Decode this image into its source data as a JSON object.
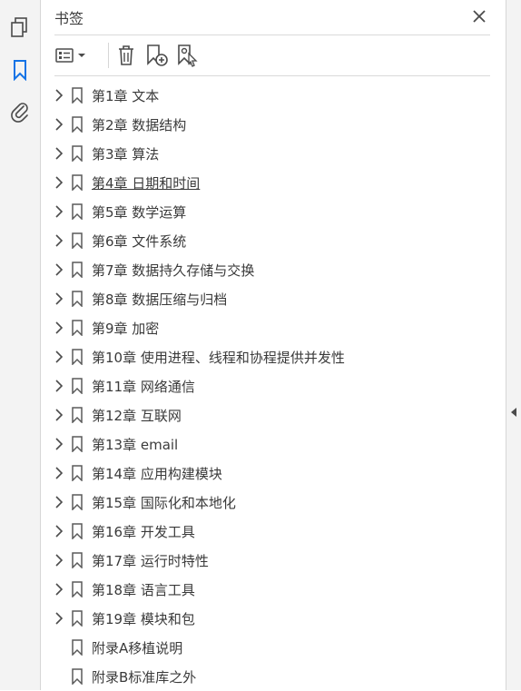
{
  "panel": {
    "title": "书签"
  },
  "bookmarks": [
    {
      "label": "第1章 文本",
      "expandable": true
    },
    {
      "label": "第2章 数据结构",
      "expandable": true
    },
    {
      "label": "第3章 算法",
      "expandable": true
    },
    {
      "label": "第4章 日期和时间",
      "expandable": true,
      "hover": true
    },
    {
      "label": "第5章 数学运算",
      "expandable": true
    },
    {
      "label": "第6章 文件系统",
      "expandable": true
    },
    {
      "label": "第7章 数据持久存储与交换",
      "expandable": true
    },
    {
      "label": "第8章 数据压缩与归档",
      "expandable": true
    },
    {
      "label": "第9章 加密",
      "expandable": true
    },
    {
      "label": "第10章 使用进程、线程和协程提供并发性",
      "expandable": true
    },
    {
      "label": "第11章 网络通信",
      "expandable": true
    },
    {
      "label": "第12章 互联网",
      "expandable": true
    },
    {
      "label": "第13章 email",
      "expandable": true
    },
    {
      "label": "第14章 应用构建模块",
      "expandable": true
    },
    {
      "label": "第15章 国际化和本地化",
      "expandable": true
    },
    {
      "label": "第16章 开发工具",
      "expandable": true
    },
    {
      "label": "第17章 运行时特性",
      "expandable": true
    },
    {
      "label": "第18章 语言工具",
      "expandable": true
    },
    {
      "label": "第19章 模块和包",
      "expandable": true
    },
    {
      "label": "附录A移植说明",
      "expandable": false
    },
    {
      "label": "附录B标准库之外",
      "expandable": false
    }
  ],
  "colors": {
    "accent": "#1473e6",
    "icon": "#4b4b4b",
    "rail": "#f3f3f3",
    "divider": "#d9d9d9"
  },
  "icons": {
    "rail": [
      "pages-icon",
      "bookmark-icon",
      "attachment-icon"
    ],
    "toolbar": [
      "options-menu-icon",
      "delete-icon",
      "new-bookmark-icon",
      "new-bookmark-from-structure-icon"
    ],
    "header": [
      "close-icon"
    ]
  }
}
